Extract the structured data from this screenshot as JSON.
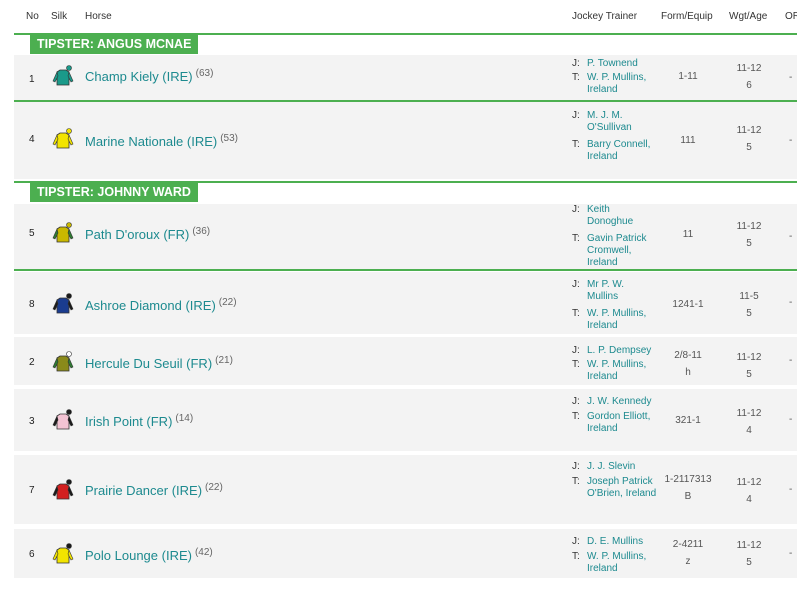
{
  "columns": {
    "no": "No",
    "silk": "Silk",
    "horse": "Horse",
    "jockey_trainer": "Jockey Trainer",
    "form_equip": "Form/Equip",
    "wgt_age": "Wgt/Age",
    "or": "OR"
  },
  "labels": {
    "jockey": "J:",
    "trainer": "T:"
  },
  "tipsters": [
    {
      "label": "TIPSTER: ANGUS MCNAE"
    },
    {
      "label": "TIPSTER: JOHNNY WARD"
    }
  ],
  "colors": {
    "accent": "#4caf50",
    "link": "#1d8a8f"
  },
  "rows": [
    {
      "no": "1",
      "horse": "Champ Kiely (IRE)",
      "days": "(63)",
      "jockey": "P. Townend",
      "trainer": "W. P. Mullins, Ireland",
      "form": "1-11",
      "equip": "",
      "wgt": "11-12",
      "age": "6",
      "or": "-",
      "silk": {
        "body": "#1a9a8a",
        "sleeve": "#1a9a8a",
        "cap": "#1a9a8a",
        "icon": "jockey-silk-teal-icon"
      }
    },
    {
      "no": "4",
      "horse": "Marine Nationale (IRE)",
      "days": "(53)",
      "jockey": "M. J. M. O'Sullivan",
      "trainer": "Barry Connell, Ireland",
      "form": "111",
      "equip": "",
      "wgt": "11-12",
      "age": "5",
      "or": "-",
      "silk": {
        "body": "#f2e400",
        "sleeve": "#f2e400",
        "cap": "#f2e400",
        "icon": "jockey-silk-yellow-black-sash-icon"
      }
    },
    {
      "no": "5",
      "horse": "Path D'oroux (FR)",
      "days": "(36)",
      "jockey": "Keith Donoghue",
      "trainer": "Gavin Patrick Cromwell, Ireland",
      "form": "11",
      "equip": "",
      "wgt": "11-12",
      "age": "5",
      "or": "-",
      "silk": {
        "body": "#c9b800",
        "sleeve": "#2e7d32",
        "cap": "#c9b800",
        "icon": "jockey-silk-green-gold-icon"
      }
    },
    {
      "no": "8",
      "horse": "Ashroe Diamond (IRE)",
      "days": "(22)",
      "jockey": "Mr P. W. Mullins",
      "trainer": "W. P. Mullins, Ireland",
      "form": "1241-1",
      "equip": "",
      "wgt": "11-5",
      "age": "5",
      "or": "-",
      "silk": {
        "body": "#1a3c8f",
        "sleeve": "#1a1a1a",
        "cap": "#1a1a1a",
        "icon": "jockey-silk-navy-star-icon"
      }
    },
    {
      "no": "2",
      "horse": "Hercule Du Seuil (FR)",
      "days": "(21)",
      "jockey": "L. P. Dempsey",
      "trainer": "W. P. Mullins, Ireland",
      "form": "2/8-11",
      "equip": "h",
      "wgt": "11-12",
      "age": "5",
      "or": "-",
      "silk": {
        "body": "#8a8a1a",
        "sleeve": "#2e7d32",
        "cap": "#ffffff",
        "icon": "jockey-silk-green-yellow-hoops-icon"
      }
    },
    {
      "no": "3",
      "horse": "Irish Point (FR)",
      "days": "(14)",
      "jockey": "J. W. Kennedy",
      "trainer": "Gordon Elliott, Ireland",
      "form": "321-1",
      "equip": "",
      "wgt": "11-12",
      "age": "4",
      "or": "-",
      "silk": {
        "body": "#f3c3d3",
        "sleeve": "#1a1a1a",
        "cap": "#1a1a1a",
        "icon": "jockey-silk-pink-black-icon"
      }
    },
    {
      "no": "7",
      "horse": "Prairie Dancer (IRE)",
      "days": "(22)",
      "jockey": "J. J. Slevin",
      "trainer": "Joseph Patrick O'Brien, Ireland",
      "form": "1-2117313",
      "equip": "B",
      "wgt": "11-12",
      "age": "4",
      "or": "-",
      "silk": {
        "body": "#d21f1f",
        "sleeve": "#1a1a1a",
        "cap": "#1a1a1a",
        "icon": "jockey-silk-red-black-icon"
      }
    },
    {
      "no": "6",
      "horse": "Polo Lounge (IRE)",
      "days": "(42)",
      "jockey": "D. E. Mullins",
      "trainer": "W. P. Mullins, Ireland",
      "form": "2-4211",
      "equip": "z",
      "wgt": "11-12",
      "age": "5",
      "or": "-",
      "silk": {
        "body": "#f2e400",
        "sleeve": "#f2e400",
        "cap": "#1a1a1a",
        "icon": "jockey-silk-yellow-check-icon"
      }
    }
  ]
}
